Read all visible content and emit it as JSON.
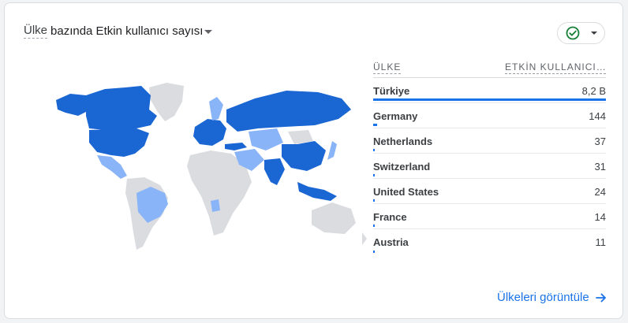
{
  "card": {
    "title_dimension": "Ülke",
    "title_metric": "bazında Etkin kullanıcı sayısı"
  },
  "status": {
    "icon": "check-circle-icon",
    "caret_icon": "caret-down-icon"
  },
  "colors": {
    "dark_blue": "#1a66d3",
    "light_blue": "#8ab4f8",
    "no_data": "#dadce0",
    "bar": "#1a73e8",
    "link": "#1a73e8",
    "check": "#188038"
  },
  "table": {
    "col_country": "ÜLKE",
    "col_metric": "ETKİN KULLANICI ...",
    "max_value": 8200,
    "rows": [
      {
        "country": "Türkiye",
        "value_label": "8,2 B",
        "value": 8200
      },
      {
        "country": "Germany",
        "value_label": "144",
        "value": 144
      },
      {
        "country": "Netherlands",
        "value_label": "37",
        "value": 37
      },
      {
        "country": "Switzerland",
        "value_label": "31",
        "value": 31
      },
      {
        "country": "United States",
        "value_label": "24",
        "value": 24
      },
      {
        "country": "France",
        "value_label": "14",
        "value": 14
      },
      {
        "country": "Austria",
        "value_label": "11",
        "value": 11
      }
    ]
  },
  "footer": {
    "link_label": "Ülkeleri görüntüle",
    "link_icon": "arrow-right-icon"
  }
}
